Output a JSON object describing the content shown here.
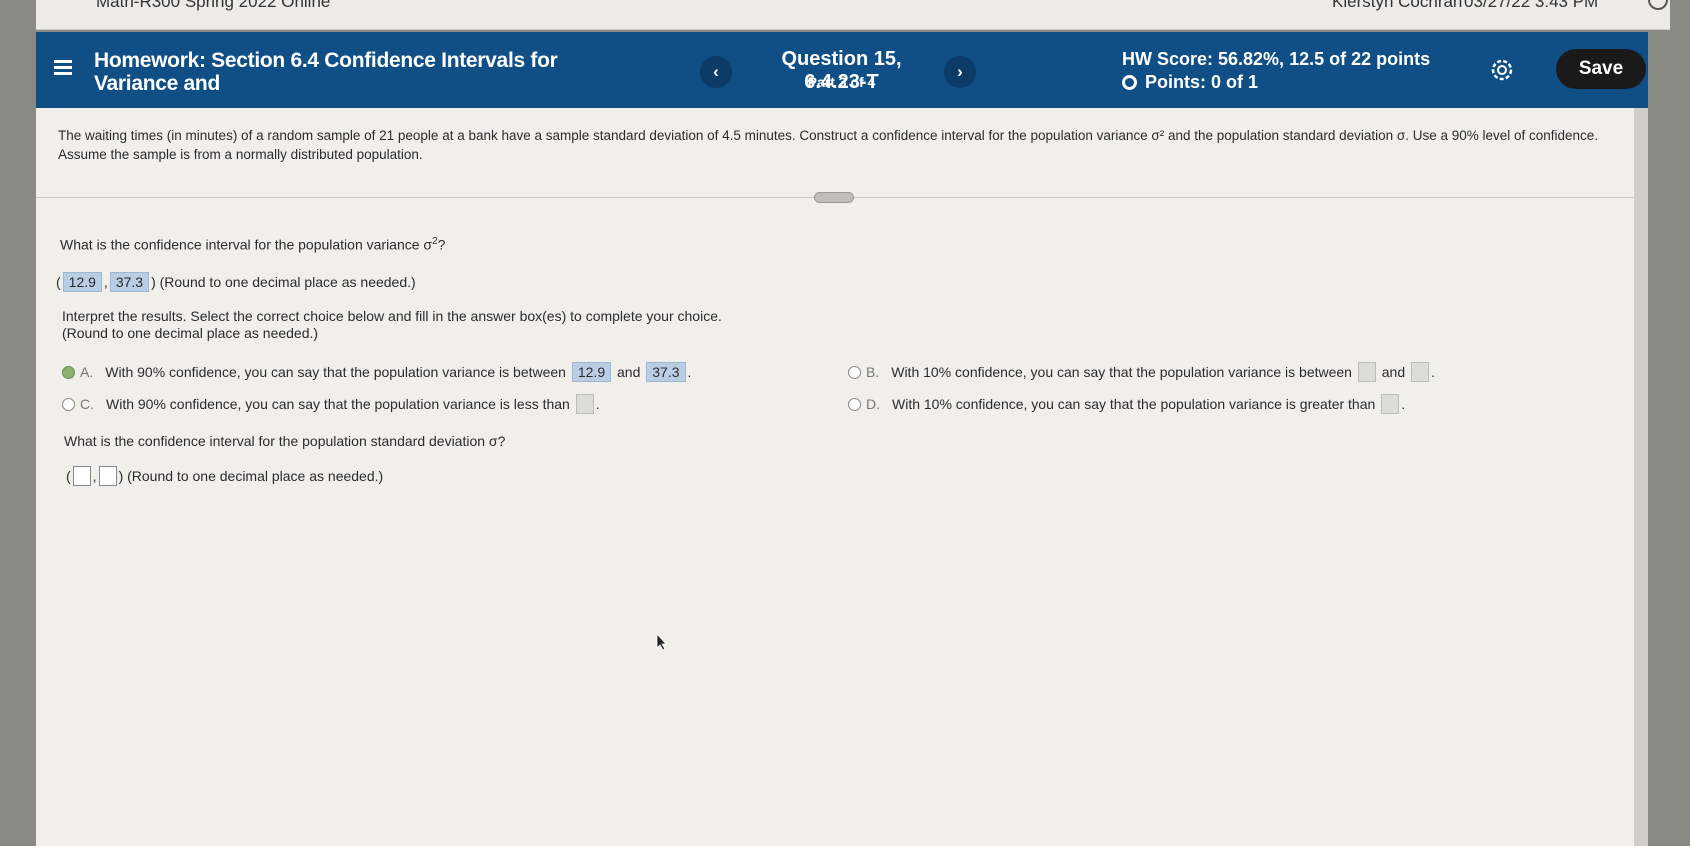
{
  "browser": {
    "course": "Math-R300 Spring 2022 Online",
    "user": "Kierstyn Cochran",
    "datetime": "03/27/22 3:43 PM"
  },
  "header": {
    "homework_title": "Homework: Section 6.4 Confidence Intervals for Variance and",
    "question_title": "Question 15, 6.4.23-T",
    "question_part": "Part 3 of 4",
    "hw_score": "HW Score: 56.82%, 12.5 of 22 points",
    "points": "Points: 0 of 1",
    "save_label": "Save",
    "prev_glyph": "‹",
    "next_glyph": "›"
  },
  "problem": {
    "text": "The waiting times (in minutes) of a random sample of 21 people at a bank have a sample standard deviation of 4.5 minutes. Construct a confidence interval for the population variance σ² and the population standard deviation σ. Use a 90% level of confidence. Assume the sample is from a normally distributed population."
  },
  "part1": {
    "question": "What is the confidence interval for the population variance σ",
    "question_end": "?",
    "lower": "12.9",
    "upper": "37.3",
    "round_note": "(Round to one decimal place as needed.)"
  },
  "interpret": {
    "line1": "Interpret the results. Select the correct choice below and fill in the answer box(es) to complete your choice.",
    "line2": "(Round to one decimal place as needed.)"
  },
  "choices": {
    "a": {
      "letter": "A.",
      "text": "With 90% confidence, you can say that the population variance is between",
      "v1": "12.9",
      "and": "and",
      "v2": "37.3"
    },
    "b": {
      "letter": "B.",
      "text": "With 10% confidence, you can say that the population variance is between",
      "and": "and"
    },
    "c": {
      "letter": "C.",
      "text": "With 90% confidence, you can say that the population variance is less than"
    },
    "d": {
      "letter": "D.",
      "text": "With 10% confidence, you can say that the population variance is greater than"
    }
  },
  "part2": {
    "question": "What is the confidence interval for the population standard deviation σ?",
    "round_note": "(Round to one decimal place as needed.)"
  },
  "colors": {
    "header_bg": "#0f4f86",
    "answer_box": "#b9cde4",
    "save_bg": "#1a1a1a"
  }
}
